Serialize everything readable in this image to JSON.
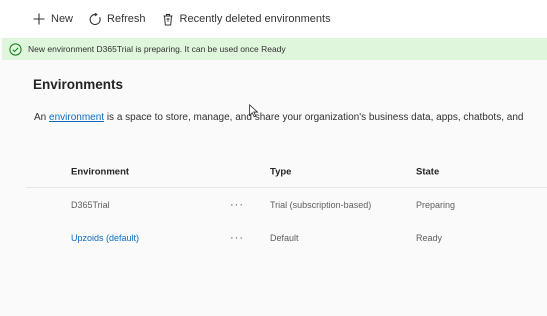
{
  "toolbar": {
    "new_label": "New",
    "refresh_label": "Refresh",
    "recently_deleted_label": "Recently deleted environments"
  },
  "banner": {
    "message": "New environment D365Trial is preparing. It can be used once Ready",
    "status_color": "#dff6dd",
    "icon": "success-circle-icon"
  },
  "main": {
    "title": "Environments",
    "description_prefix": "An ",
    "description_link": "environment",
    "description_suffix": " is a space to store, manage, and share your organization's business data, apps, chatbots, and"
  },
  "table": {
    "columns": [
      "Environment",
      "Type",
      "State"
    ],
    "rows": [
      {
        "environment": "D365Trial",
        "more": "···",
        "type": "Trial (subscription-based)",
        "state": "Preparing"
      },
      {
        "environment": "Upzoids (default)",
        "more": "···",
        "type": "Default",
        "state": "Ready"
      }
    ]
  },
  "colors": {
    "accent": "#0f6cbd",
    "success_bg": "#dff6dd",
    "success_icon": "#107c10"
  }
}
